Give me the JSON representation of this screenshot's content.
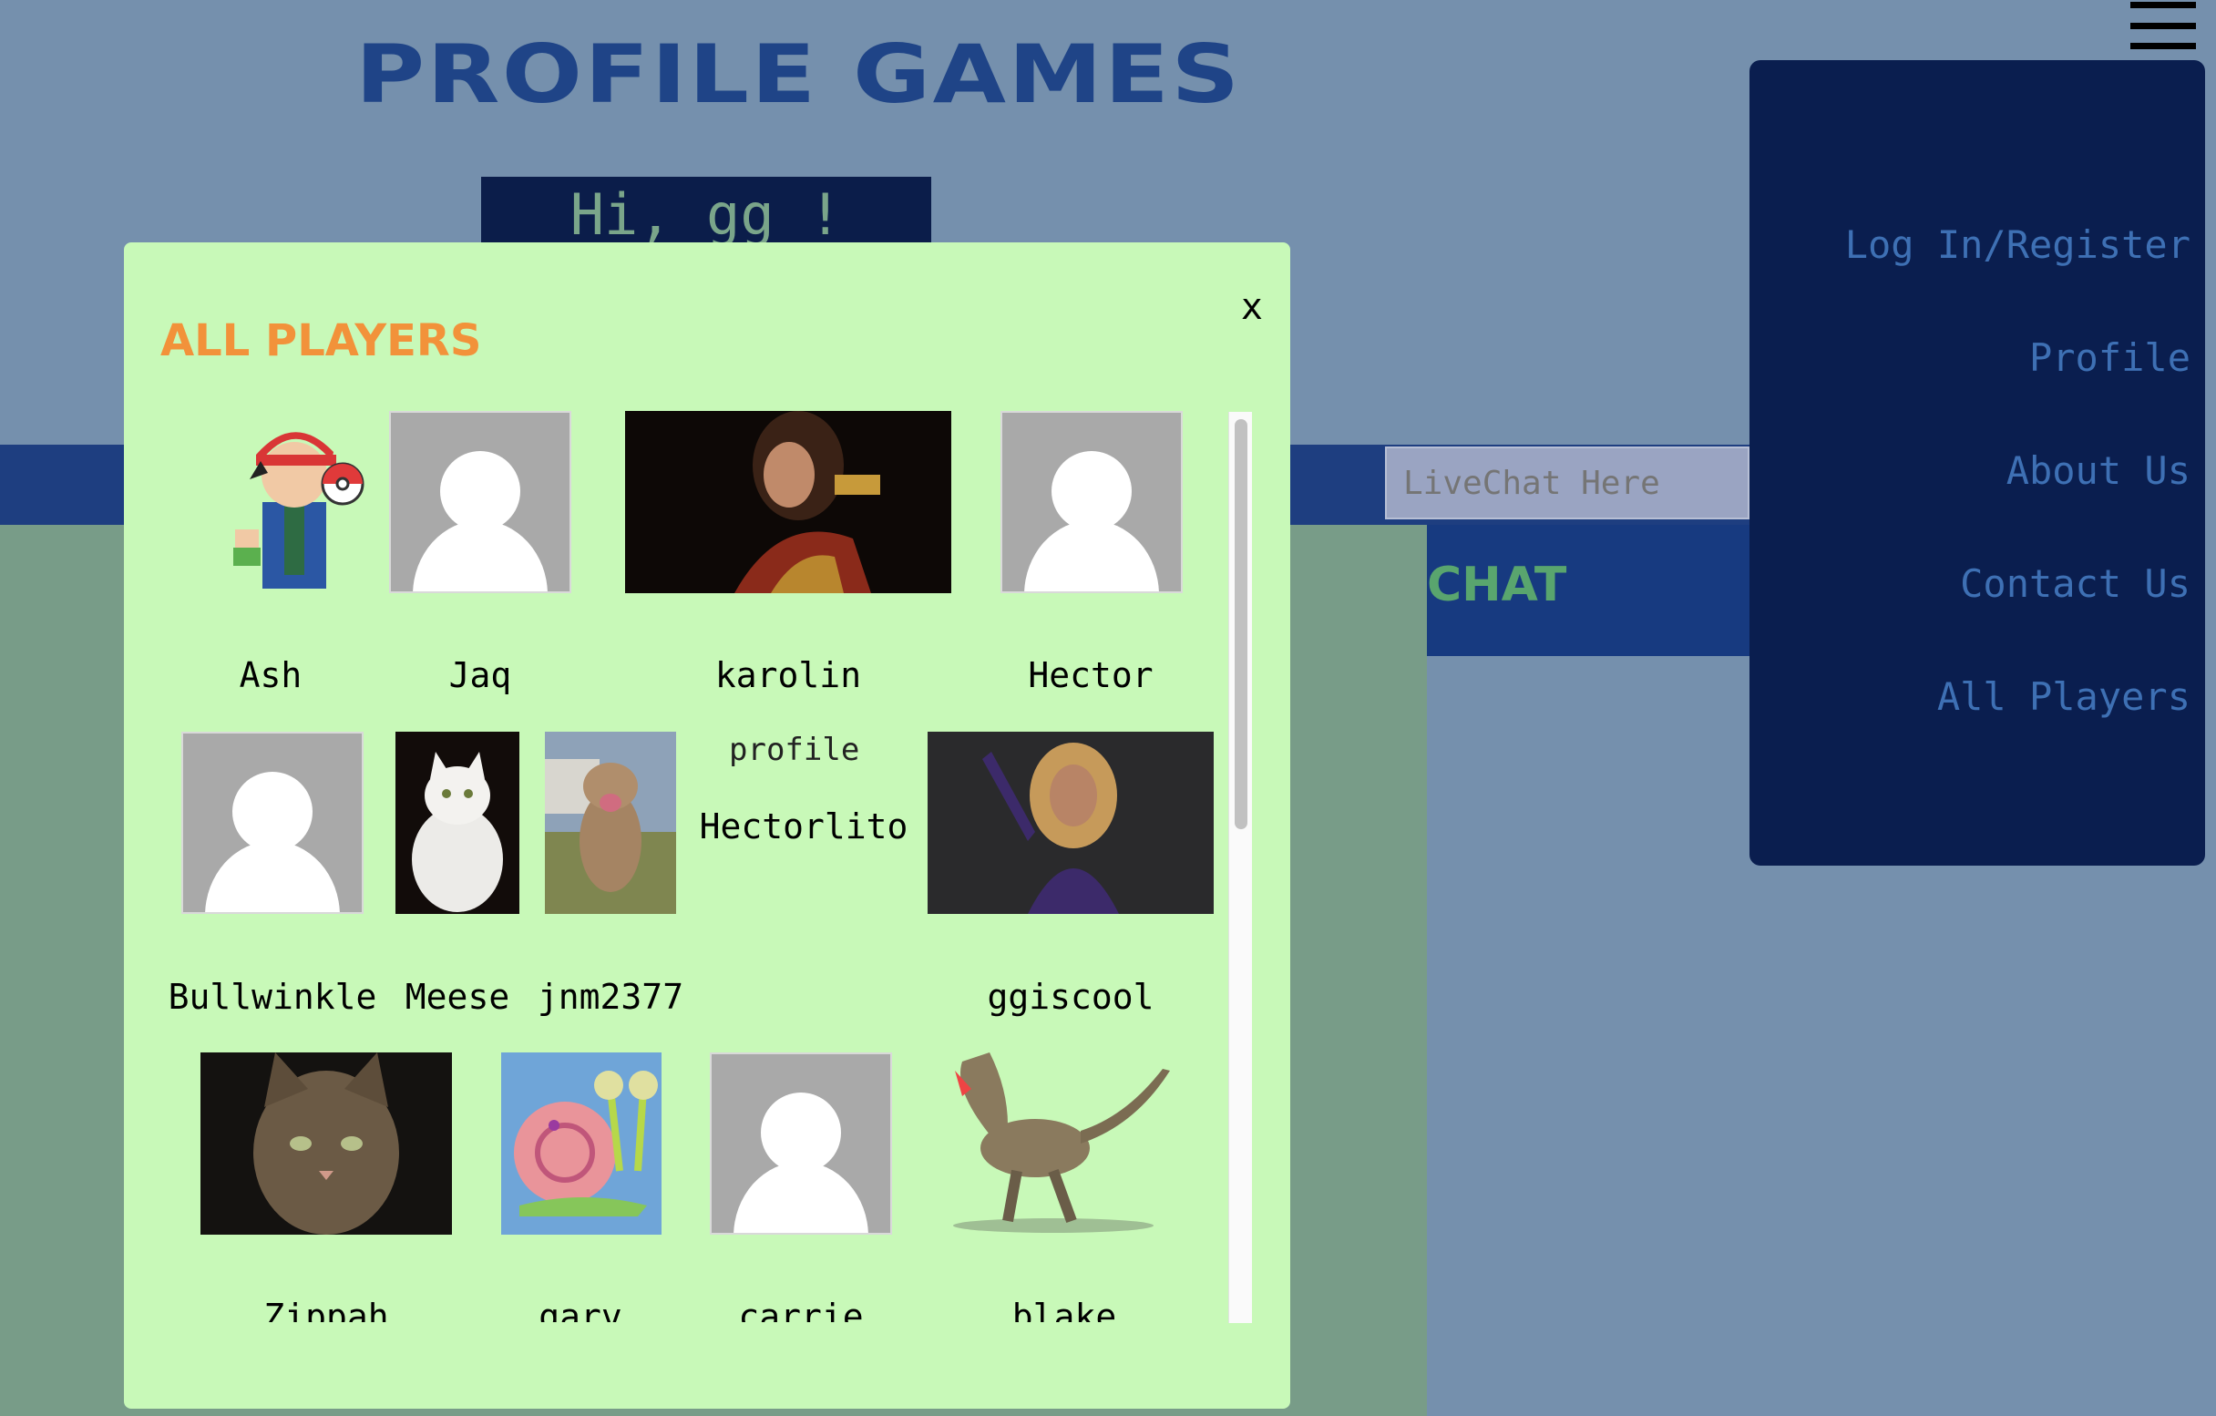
{
  "site": {
    "title": "PROFILE GAMES",
    "greeting": "Hi, gg !"
  },
  "chat": {
    "placeholder": "LiveChat Here",
    "label": "CHAT"
  },
  "nav": {
    "items": [
      "Log In/Register",
      "Profile",
      "About Us",
      "Contact Us",
      "All Players"
    ]
  },
  "modal": {
    "title": "ALL PLAYERS",
    "close": "x",
    "players": [
      {
        "name": "Ash",
        "image": "ash-cartoon"
      },
      {
        "name": "Jaq",
        "image": "default-avatar"
      },
      {
        "name": "karolin",
        "image": "wonder-woman-photo"
      },
      {
        "name": "Hector",
        "image": "default-avatar"
      },
      {
        "name": "Bullwinkle",
        "image": "default-avatar"
      },
      {
        "name": "Meese",
        "image": "white-cat-photo"
      },
      {
        "name": "jnm2377",
        "image": "dog-photo"
      },
      {
        "name": "Hectorlito",
        "image": "broken-image",
        "alt": "profile"
      },
      {
        "name": "ggiscool",
        "image": "singer-photo"
      },
      {
        "name": "Zippah",
        "image": "tabby-cat-photo"
      },
      {
        "name": "garv",
        "image": "snail-cartoon"
      },
      {
        "name": "carrie",
        "image": "default-avatar"
      },
      {
        "name": "blake",
        "image": "dinosaur-photo"
      }
    ]
  },
  "colors": {
    "background": "#7590ad",
    "title": "#1f4487",
    "modal": "#c8f9b8",
    "modal_title": "#f2923a",
    "nav_panel": "#0a1e4f",
    "nav_text": "#3e70b4"
  }
}
